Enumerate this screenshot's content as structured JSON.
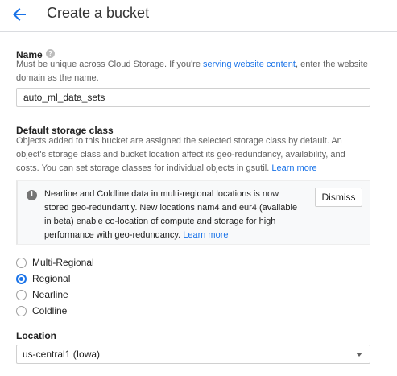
{
  "header": {
    "title": "Create a bucket",
    "back_icon": "arrow-back-icon"
  },
  "name_section": {
    "label": "Name",
    "help_icon": "help-icon",
    "help_glyph": "?",
    "desc_prefix": "Must be unique across Cloud Storage. If you're ",
    "desc_link": "serving website content",
    "desc_suffix": ", enter the website",
    "desc_line2": "domain as the name.",
    "value": "auto_ml_data_sets"
  },
  "storage_class": {
    "label": "Default storage class",
    "desc_line1": "Objects added to this bucket are assigned the selected storage class by default. An",
    "desc_line2": "object's storage class and bucket location affect its geo-redundancy, availability, and",
    "desc_line3_prefix": "costs. You can set storage classes for individual objects in gsutil. ",
    "desc_link": "Learn more",
    "notice": {
      "icon": "info-icon",
      "icon_glyph": "i",
      "line1": "Nearline and Coldline data in multi-regional locations is now",
      "line2": "stored geo-redundantly. New locations nam4 and eur4 (available",
      "line3": "in beta) enable co-location of compute and storage for high",
      "line4_prefix": "performance with geo-redundancy. ",
      "link": "Learn more",
      "dismiss_label": "Dismiss"
    },
    "options": [
      "Multi-Regional",
      "Regional",
      "Nearline",
      "Coldline"
    ],
    "selected": "Regional"
  },
  "location": {
    "label": "Location",
    "value": "us-central1 (Iowa)"
  },
  "colors": {
    "accent": "#1a73e8",
    "text": "#212121",
    "muted": "#616161"
  }
}
